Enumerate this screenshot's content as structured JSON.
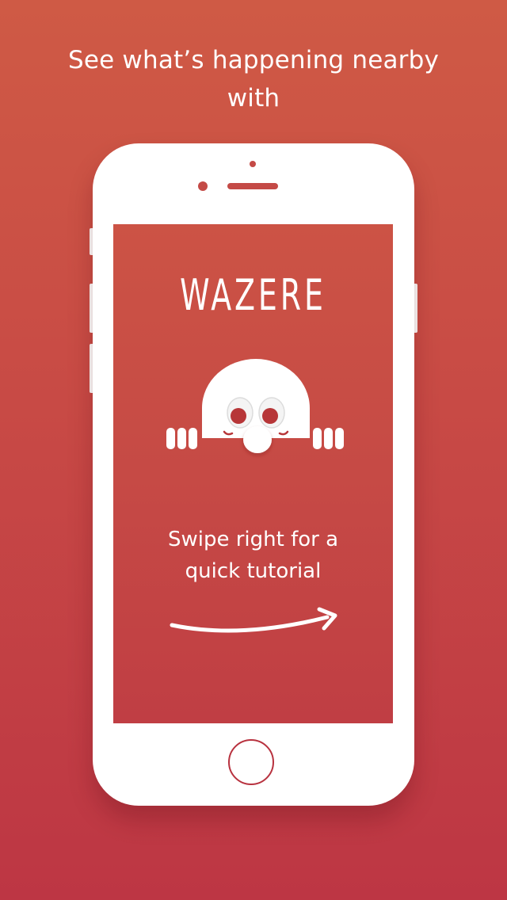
{
  "headline": {
    "line1": "See what’s happening nearby",
    "line2": "with"
  },
  "screen": {
    "brand": "WAZERE",
    "tagline": {
      "line1": "Swipe right for a",
      "line2": "quick tutorial"
    }
  },
  "colors": {
    "background_top": "#cf5a45",
    "background_bottom": "#bd3644",
    "phone": "#ffffff",
    "accent": "#c44a46",
    "eye": "#b73638"
  },
  "icons": {
    "mascot": "peeking-face-icon",
    "arrow": "swipe-right-arrow-icon",
    "home": "home-button-icon"
  }
}
